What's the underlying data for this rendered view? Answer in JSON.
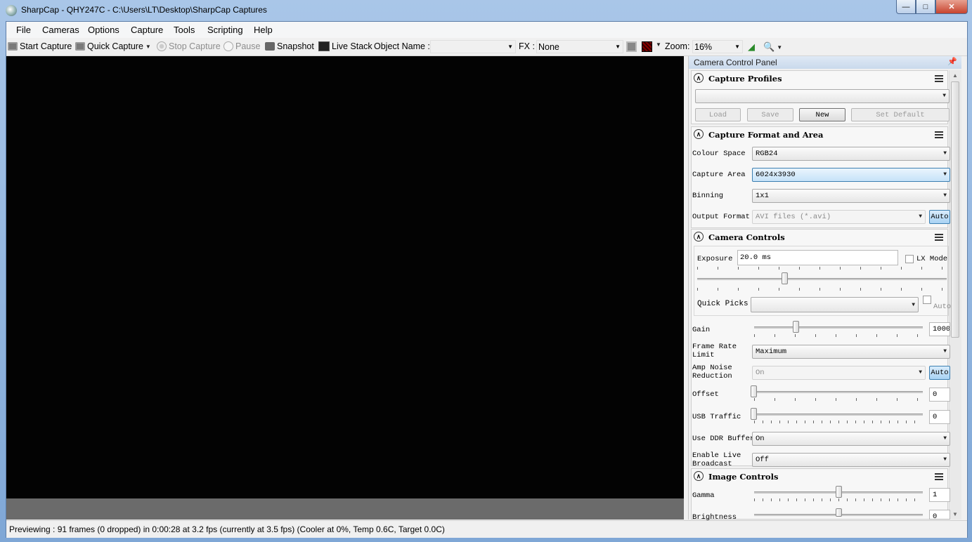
{
  "window": {
    "title": "SharpCap - QHY247C - C:\\Users\\LT\\Desktop\\SharpCap Captures",
    "min_icon": "minimize-icon",
    "max_icon": "maximize-icon",
    "close_icon": "close-icon"
  },
  "menu": {
    "items": [
      {
        "label": "File"
      },
      {
        "label": "Cameras"
      },
      {
        "label": "Options"
      },
      {
        "label": "Capture"
      },
      {
        "label": "Tools"
      },
      {
        "label": "Scripting"
      },
      {
        "label": "Help"
      }
    ]
  },
  "toolbar": {
    "start_capture": "Start Capture",
    "quick_capture": "Quick Capture",
    "stop_capture": "Stop Capture",
    "pause": "Pause",
    "snapshot": "Snapshot",
    "live_stack": "Live Stack",
    "object_name_label": "Object Name :",
    "object_name_value": "",
    "fx_label": "FX :",
    "fx_value": "None",
    "zoom_label": "Zoom:",
    "zoom_value": "16%"
  },
  "status": {
    "text": "Previewing : 91 frames (0 dropped) in 0:00:28 at 3.2 fps  (currently at 3.5 fps) (Cooler at 0%, Temp 0.6C, Target 0.0C)"
  },
  "panel": {
    "title": "Camera Control Panel",
    "capture_profiles": {
      "title": "Capture Profiles",
      "selected": "",
      "load": "Load",
      "save": "Save",
      "new": "New",
      "set_default": "Set Default"
    },
    "capture_format": {
      "title": "Capture Format and Area",
      "colour_space_label": "Colour Space",
      "colour_space_value": "RGB24",
      "capture_area_label": "Capture Area",
      "capture_area_value": "6024x3930",
      "binning_label": "Binning",
      "binning_value": "1x1",
      "output_format_label": "Output Format",
      "output_format_value": "AVI files (*.avi)",
      "auto": "Auto"
    },
    "camera_controls": {
      "title": "Camera Controls",
      "exposure_label": "Exposure",
      "exposure_value": "20.0 ms",
      "lx_mode": "LX Mode",
      "quick_picks_label": "Quick Picks",
      "quick_picks_value": "",
      "quick_picks_auto": "Auto",
      "gain_label": "Gain",
      "gain_value": "1000",
      "frame_rate_label_1": "Frame Rate",
      "frame_rate_label_2": "Limit",
      "frame_rate_value": "Maximum",
      "amp_noise_label_1": "Amp Noise",
      "amp_noise_label_2": "Reduction",
      "amp_noise_value": "On",
      "amp_noise_auto": "Auto",
      "offset_label": "Offset",
      "offset_value": "0",
      "usb_label": "USB Traffic",
      "usb_value": "0",
      "ddr_label": "Use DDR Buffer",
      "ddr_value": "On",
      "broadcast_label_1": "Enable Live",
      "broadcast_label_2": "Broadcast",
      "broadcast_value": "Off"
    },
    "image_controls": {
      "title": "Image Controls",
      "gamma_label": "Gamma",
      "gamma_value": "1",
      "brightness_label": "Brightness",
      "brightness_value": "0"
    }
  }
}
